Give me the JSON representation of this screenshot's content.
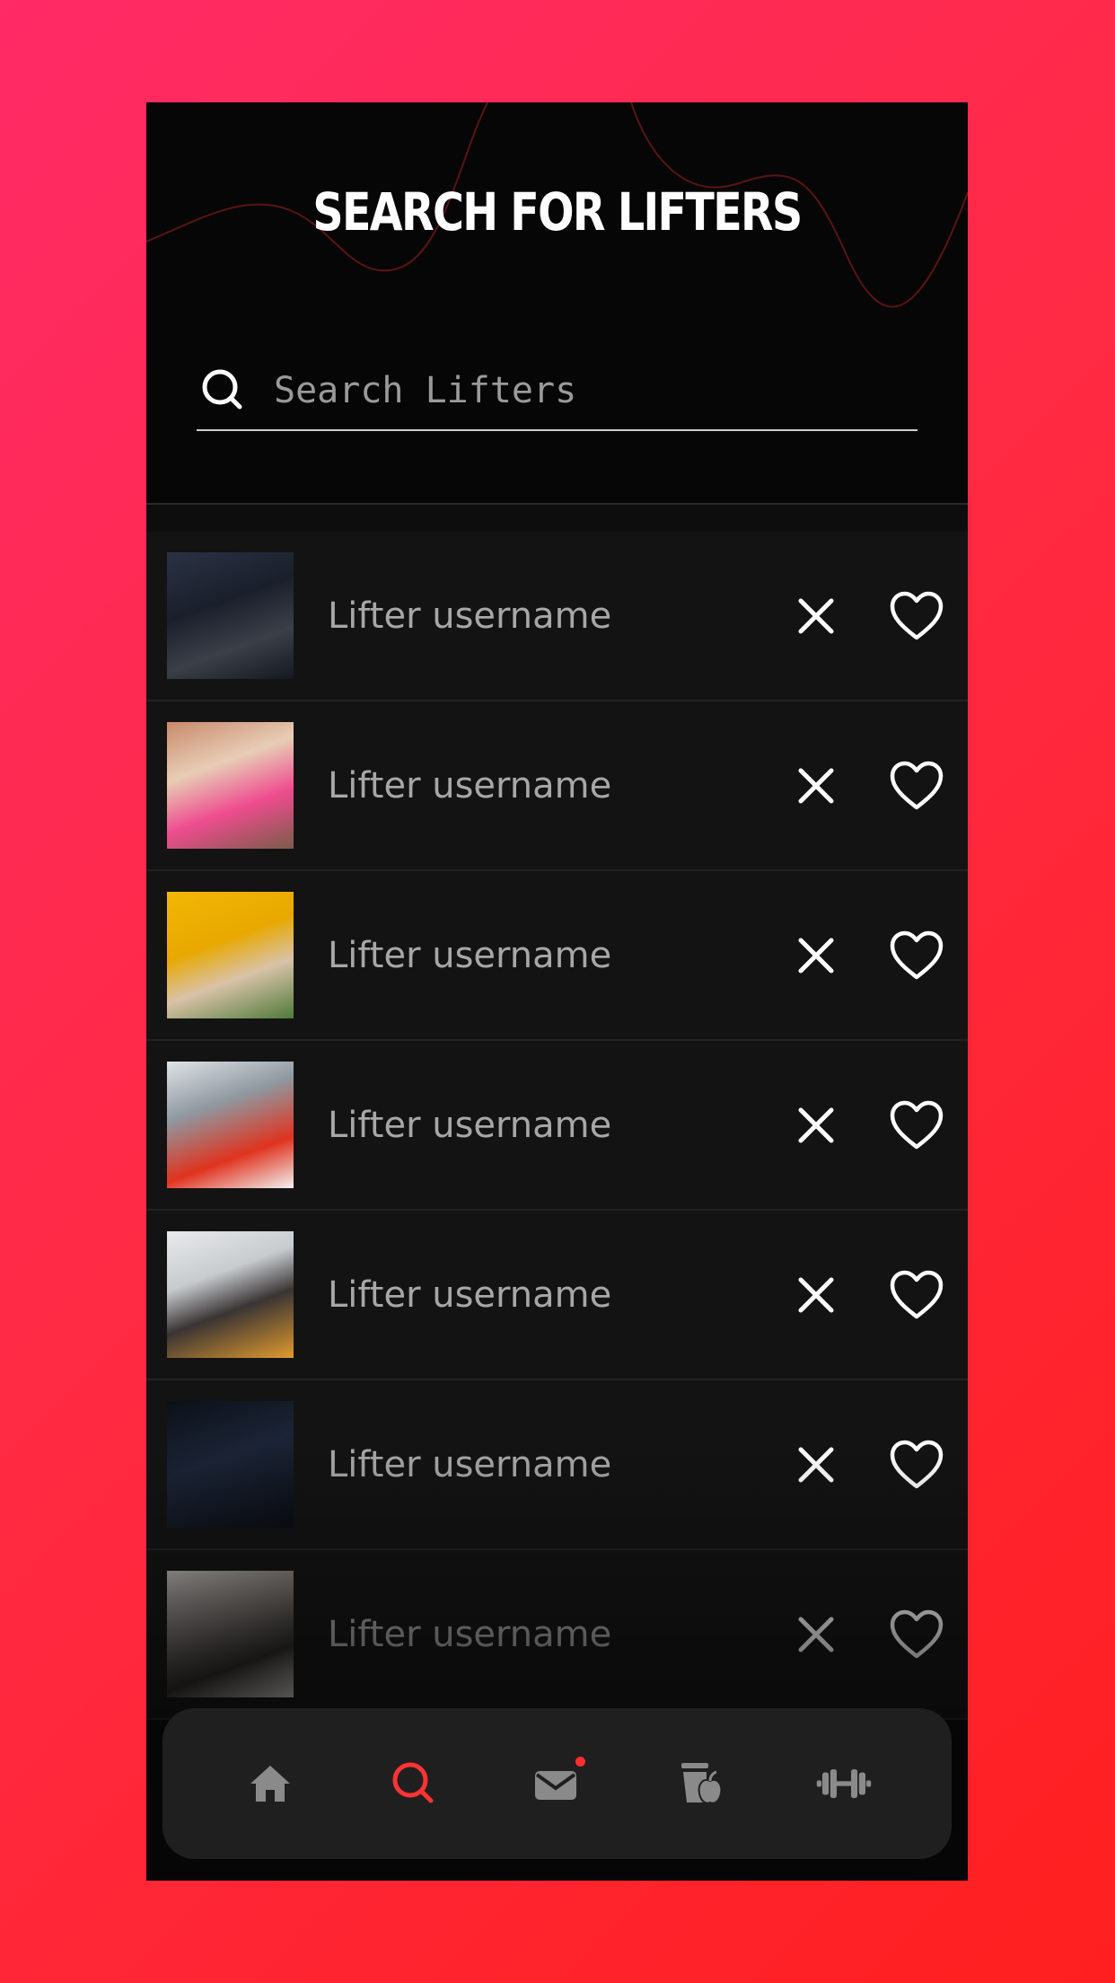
{
  "header": {
    "title": "SEARCH FOR LIFTERS"
  },
  "search": {
    "placeholder": "Search Lifters",
    "icon": "search-icon"
  },
  "lifters": [
    {
      "username": "Lifter username",
      "thumb": "man-at-cable-machine"
    },
    {
      "username": "Lifter username",
      "thumb": "woman-pink-dumbbell"
    },
    {
      "username": "Lifter username",
      "thumb": "woman-eating-salad-yellow"
    },
    {
      "username": "Lifter username",
      "thumb": "man-towel-red-shirt"
    },
    {
      "username": "Lifter username",
      "thumb": "woman-phone-bottle"
    },
    {
      "username": "Lifter username",
      "thumb": "hooded-figure-dark"
    },
    {
      "username": "Lifter username",
      "thumb": "woman-holding-plate"
    }
  ],
  "nav": {
    "items": [
      {
        "icon": "home-icon",
        "active": false
      },
      {
        "icon": "search-icon",
        "active": true
      },
      {
        "icon": "mail-icon",
        "active": false,
        "notification": true
      },
      {
        "icon": "nutrition-icon",
        "active": false
      },
      {
        "icon": "dumbbell-icon",
        "active": false
      }
    ]
  },
  "colors": {
    "accent": "#ff3333",
    "background": "#060606",
    "row": "#131313",
    "nav_bg": "#1f1f1f",
    "inactive_icon": "#8a8a8a"
  }
}
